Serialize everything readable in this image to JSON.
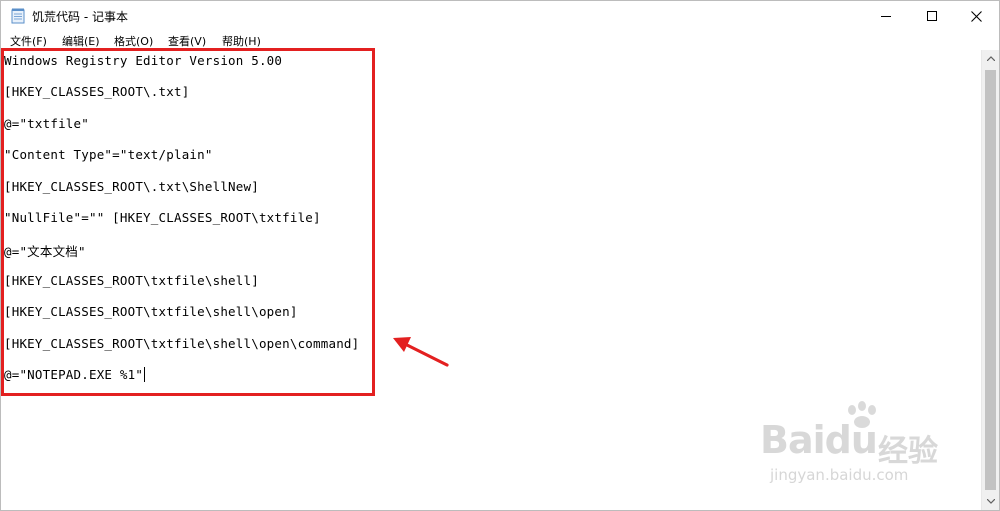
{
  "window": {
    "title": "饥荒代码 - 记事本"
  },
  "menu": [
    {
      "label": "文件(F)"
    },
    {
      "label": "编辑(E)"
    },
    {
      "label": "格式(O)"
    },
    {
      "label": "查看(V)"
    },
    {
      "label": "帮助(H)"
    }
  ],
  "editor": {
    "lines": [
      "Windows Registry Editor Version 5.00",
      "[HKEY_CLASSES_ROOT\\.txt]",
      "@=\"txtfile\"",
      "\"Content Type\"=\"text/plain\"",
      "[HKEY_CLASSES_ROOT\\.txt\\ShellNew]",
      "\"NullFile\"=\"\" [HKEY_CLASSES_ROOT\\txtfile]",
      "@=\"文本文档\"",
      "[HKEY_CLASSES_ROOT\\txtfile\\shell]",
      "[HKEY_CLASSES_ROOT\\txtfile\\shell\\open]",
      "[HKEY_CLASSES_ROOT\\txtfile\\shell\\open\\command]",
      "@=\"NOTEPAD.EXE %1\""
    ]
  },
  "annotation": {
    "color": "#e32020"
  },
  "watermark": {
    "brand": "Baidu",
    "brand_cn": "经验",
    "url": "jingyan.baidu.com"
  },
  "icons": {
    "app": "notepad-icon",
    "minimize": "minimize-icon",
    "maximize": "maximize-icon",
    "close": "close-icon"
  }
}
